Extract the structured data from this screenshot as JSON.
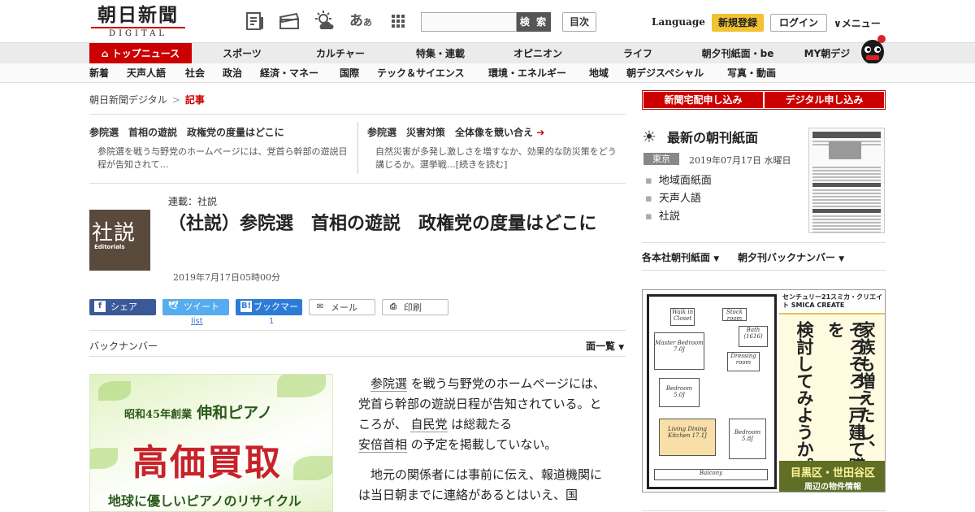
{
  "header": {
    "logo_jp": "朝日新聞",
    "logo_sub": "DIGITAL",
    "search_placeholder": "",
    "search_button": "検 索",
    "mokuji_button": "目次",
    "language": "Language",
    "register": "新規登録",
    "login": "ログイン",
    "menu": "メニュー"
  },
  "main_nav": [
    "トップニュース",
    "スポーツ",
    "カルチャー",
    "特集・連載",
    "オピニオン",
    "ライフ",
    "朝夕刊紙面・be",
    "MY朝デジ"
  ],
  "sub_nav": [
    "新着",
    "天声人語",
    "社会",
    "政治",
    "経済・マネー",
    "国際",
    "テック＆サイエンス",
    "環境・エネルギー",
    "地域",
    "朝デジスペシャル",
    "写真・動画"
  ],
  "breadcrumb": {
    "home": "朝日新聞デジタル",
    "sep": ">",
    "current": "記事"
  },
  "related": [
    {
      "title": "参院選　首相の遊説　政権党の度量はどこに",
      "desc": "参院選を戦う与野党のホームページには、党首ら幹部の遊説日程が告知されて…"
    },
    {
      "title": "参院選　災害対策　全体像を競い合え",
      "desc": "自然災害が多発し激しさを増すなか、効果的な防災策をどう講じるか。選挙戦…[続きを読む]"
    }
  ],
  "article": {
    "logo_big": "社説",
    "logo_small": "Editorials",
    "series": "連載：社説",
    "headline": "（社説）参院選　首相の遊説　政権党の度量はどこに",
    "dateline": "2019年7月17日05時00分",
    "p1": {
      "k1": "参院選",
      "t1": "を戦う与野党のホームページには、党首ら幹部の遊説日程が告知されている。ところが、",
      "k2": "自民党",
      "t2": "は総裁たる",
      "k3": "安倍首相",
      "t3": "の予定を掲載していない。"
    },
    "p2": "地元の関係者には事前に伝え、報道機関には当日朝までに連絡があるとはいえ、国"
  },
  "share": {
    "facebook": "シェア",
    "twitter": "ツイート",
    "hatena": "ブックマーク",
    "mail": "メール",
    "print": "印刷",
    "twitter_count": "list",
    "hatena_count": "1"
  },
  "backnumber": "バックナンバー",
  "menlist": "面一覧",
  "ad_piano": {
    "line1": "昭和45年創業",
    "brand": "伸和ピアノ",
    "main": "高価買取",
    "sub": "地球に優しいピアノのリサイクル"
  },
  "sidebar": {
    "btn1": "新聞宅配申し込み",
    "btn2": "デジタル申し込み",
    "morning_title": "最新の朝刊紙面",
    "region": "東京",
    "date": "2019年07月17日 水曜日",
    "links": [
      "地域面紙面",
      "天声人語",
      "社説"
    ],
    "dd1": "各本社朝刊紙面",
    "dd2": "朝夕刊バックナンバー"
  },
  "ad_estate": {
    "brand": "センチュリー21スミカ・クリエイト SMICA CREATE",
    "col1": "家族も増えたし、",
    "col2": "そろそろ一戸建て購入を",
    "col3": "検討してみようか。",
    "area": "目黒区・世田谷区",
    "area_sub": "周辺の物件情報",
    "rooms": [
      "Walk in Closet",
      "Stock room",
      "Master Bedroom 7.0J",
      "Bath (1616)",
      "Dressing room",
      "Bedroom 5.0J",
      "Living Dining Kitchen 17.1J",
      "Bedroom 5.8J",
      "Balcony"
    ]
  }
}
